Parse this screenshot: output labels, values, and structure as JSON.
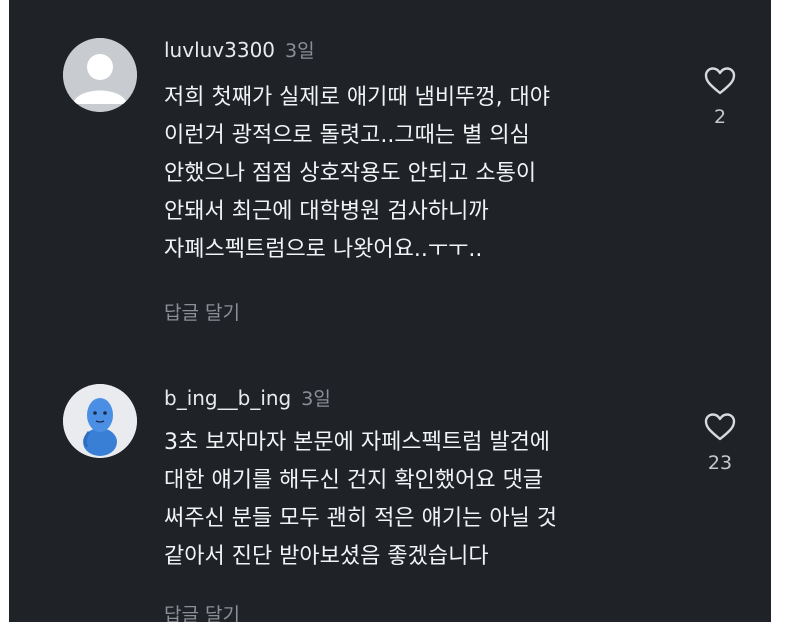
{
  "comments": [
    {
      "username": "luvluv3300",
      "time": "3일",
      "lines": [
        "저희 첫째가 실제로 애기때 냄비뚜껑, 대야",
        "이런거 광적으로 돌렷고..그때는 별 의심",
        "안했으나 점점 상호작용도 안되고 소통이",
        "안돼서 최근에 대학병원 검사하니까",
        "자폐스펙트럼으로 나왓어요..ㅜㅜ.."
      ],
      "reply_label": "답글 달기",
      "like_count": "2",
      "avatar_icon": "default-avatar-icon"
    },
    {
      "username": "b_ing__b_ing",
      "time": "3일",
      "lines": [
        "3초 보자마자 본문에 자페스펙트럼 발견에",
        "대한 얘기를 해두신 건지 확인했어요 댓글",
        "써주신 분들 모두 괜히 적은 얘기는 아닐 것",
        "같아서 진단 받아보셨음 좋겠습니다"
      ],
      "reply_label": "답글 달기",
      "like_count": "23",
      "avatar_icon": "blue-doll-avatar-icon"
    }
  ],
  "colors": {
    "background": "#1f2227",
    "text": "#f2f3f5",
    "muted": "#8c9096",
    "avatar_default_bg": "#c8cbd0",
    "avatar_default_fg": "#ffffff",
    "avatar_doll": "#3a7fd6"
  }
}
